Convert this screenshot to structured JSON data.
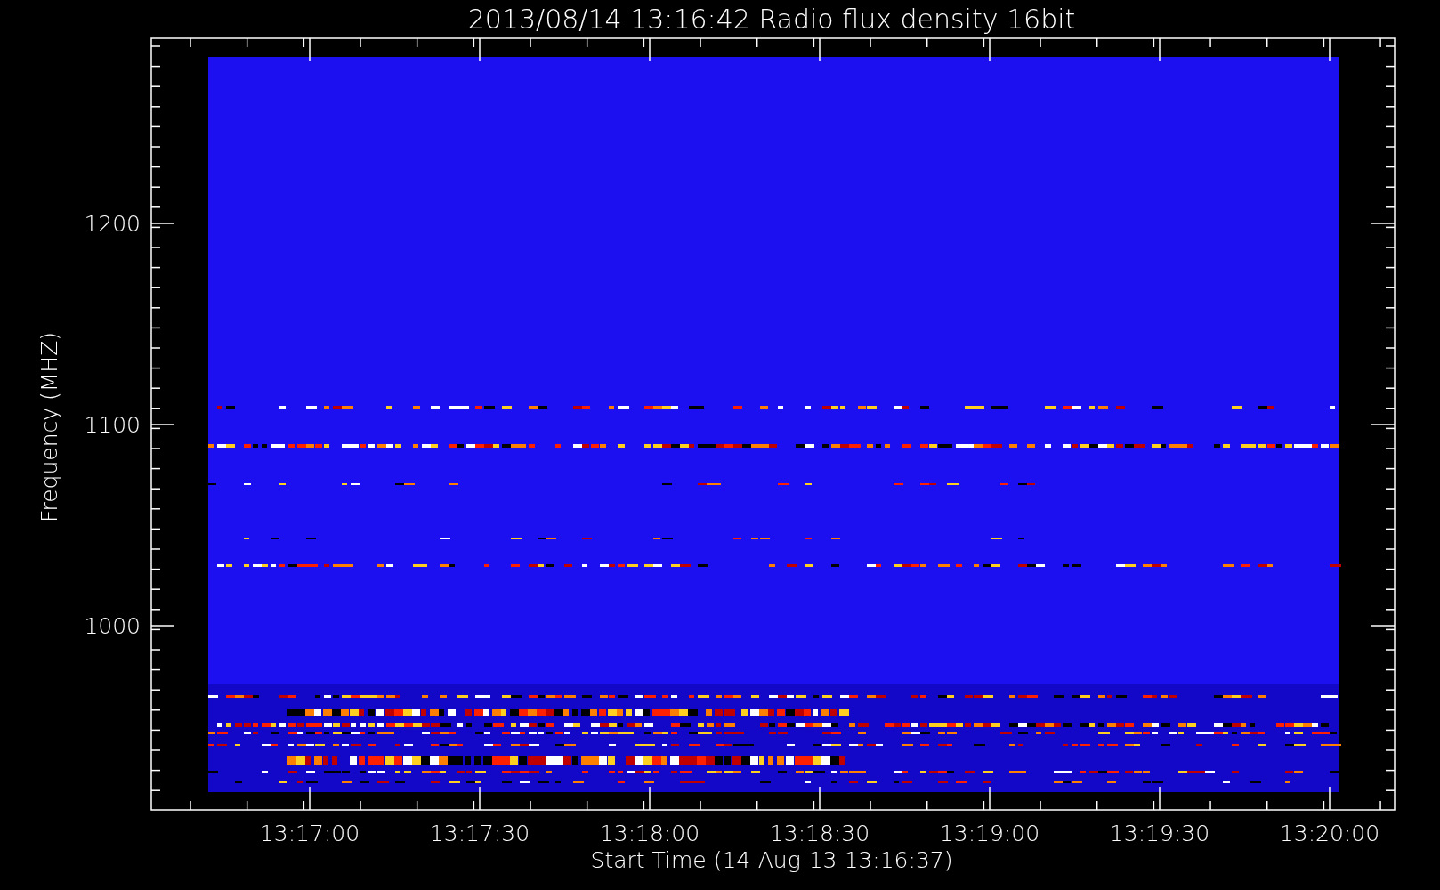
{
  "title": "2013/08/14 13:16:42 Radio flux density 16bit",
  "xlabel": "Start Time (14-Aug-13 13:16:37)",
  "ylabel": "Frequency (MHZ)",
  "xticks": [
    "13:17:00",
    "13:17:30",
    "13:18:00",
    "13:18:30",
    "13:19:00",
    "13:19:30",
    "13:20:00"
  ],
  "yticks": [
    "1200",
    "1100",
    "1000"
  ]
}
